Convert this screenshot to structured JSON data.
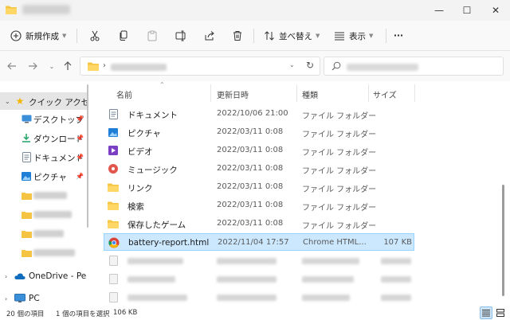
{
  "toolbar": {
    "new_label": "新規作成",
    "sort_label": "並べ替え",
    "view_label": "表示",
    "more_label": "···"
  },
  "window": {
    "minimize": "—",
    "maximize": "☐",
    "close": "✕"
  },
  "sidebar": {
    "quick_access": "クイック アクセス",
    "items": [
      {
        "label": "デスクトップ"
      },
      {
        "label": "ダウンロード"
      },
      {
        "label": "ドキュメント"
      },
      {
        "label": "ピクチャ"
      }
    ],
    "onedrive": "OneDrive - Pe",
    "pc": "PC"
  },
  "columns": {
    "name": "名前",
    "date": "更新日時",
    "type": "種類",
    "size": "サイズ"
  },
  "files": [
    {
      "name": "ドキュメント",
      "date": "2022/10/06 21:00",
      "type": "ファイル フォルダー",
      "size": ""
    },
    {
      "name": "ピクチャ",
      "date": "2022/03/11 0:08",
      "type": "ファイル フォルダー",
      "size": ""
    },
    {
      "name": "ビデオ",
      "date": "2022/03/11 0:08",
      "type": "ファイル フォルダー",
      "size": ""
    },
    {
      "name": "ミュージック",
      "date": "2022/03/11 0:08",
      "type": "ファイル フォルダー",
      "size": ""
    },
    {
      "name": "リンク",
      "date": "2022/03/11 0:08",
      "type": "ファイル フォルダー",
      "size": ""
    },
    {
      "name": "検索",
      "date": "2022/03/11 0:08",
      "type": "ファイル フォルダー",
      "size": ""
    },
    {
      "name": "保存したゲーム",
      "date": "2022/03/11 0:08",
      "type": "ファイル フォルダー",
      "size": ""
    },
    {
      "name": "battery-report.html",
      "date": "2022/11/04 17:57",
      "type": "Chrome HTML...",
      "size": "107 KB"
    }
  ],
  "status": {
    "count": "20 個の項目",
    "selection": "1 個の項目を選択",
    "selection_size": "106 KB"
  },
  "colors": {
    "selected_bg": "#cce8ff",
    "selected_border": "#99d1ff",
    "folder": "#f5c443",
    "accent": "#0067c0"
  }
}
